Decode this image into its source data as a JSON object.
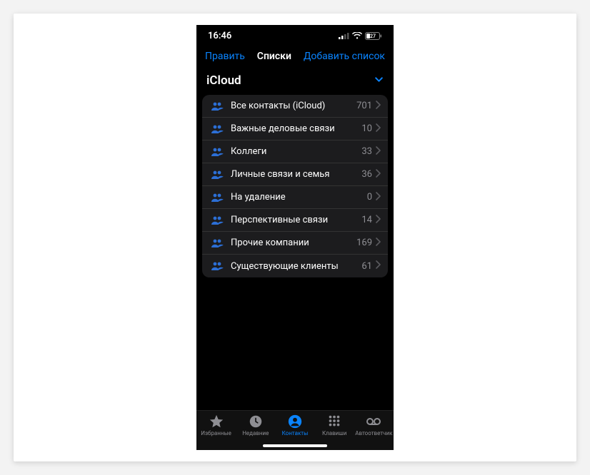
{
  "status": {
    "time": "16:46",
    "battery": "27"
  },
  "nav": {
    "edit": "Править",
    "title": "Списки",
    "add": "Добавить список"
  },
  "section": {
    "title": "iCloud"
  },
  "lists": [
    {
      "label": "Все контакты (iCloud)",
      "count": "701"
    },
    {
      "label": "Важные деловые связи",
      "count": "10"
    },
    {
      "label": "Коллеги",
      "count": "33"
    },
    {
      "label": "Личные связи и семья",
      "count": "36"
    },
    {
      "label": "На удаление",
      "count": "0"
    },
    {
      "label": "Перспективные связи",
      "count": "14"
    },
    {
      "label": "Прочие компании",
      "count": "169"
    },
    {
      "label": "Существующие клиенты",
      "count": "61"
    }
  ],
  "tabs": {
    "favorites": "Избранные",
    "recents": "Недавние",
    "contacts": "Контакты",
    "keypad": "Клавиши",
    "voicemail": "Автоответчик"
  }
}
